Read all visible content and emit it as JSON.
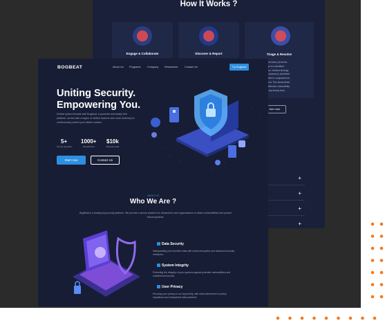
{
  "back_page": {
    "section_title": "How It Works ?",
    "cards": [
      {
        "label": "Engage & Collaborate",
        "icon": "collaborate-illustration"
      },
      {
        "label": "Discover & Report",
        "icon": "hacker-illustration"
      },
      {
        "label": "Triage & Resolve",
        "icon": "triage-illustration"
      }
    ],
    "triage_text_lines": [
      "xpert team performs",
      "age on submitted",
      "ures. Verified findings",
      "ly assessed, prioritized",
      "cated to companies for",
      "ment. This streamlined",
      "s effective vulnerability",
      "nt and timely fixes."
    ],
    "join_label": "Join now",
    "faq_items": [
      "+",
      "+",
      "+",
      "+"
    ]
  },
  "front_page": {
    "logo": "BOGBEAT",
    "nav": [
      "About Us",
      "Programs",
      "Company",
      "Researcher",
      "Contact Us"
    ],
    "login_label": "Try Bugbeat",
    "hero_title_line1": "Uniting Security.",
    "hero_title_line2": "Empowering You.",
    "hero_desc": "Defeat cybercriminals with Bugbeat, a powerful and totally free platform, armed with a legion of skilled hackers who work tirelessly to continuously protect your attack surface.",
    "stats": [
      {
        "value": "5+",
        "label": "bounty programs"
      },
      {
        "value": "1000+",
        "label": "Researchers"
      },
      {
        "value": "$10k",
        "label": "Bounties paid"
      }
    ],
    "start_label": "Start now",
    "contact_label": "Contact Us",
    "about_tag": "ABOUT US",
    "about_title": "Who We Are ?",
    "about_desc": "BugBeat is a leading bug bounty platform. We provide a secure platform for researchers and organizations to detect vulnerabilities and protect critical systems.",
    "features": [
      {
        "title": "Data Security",
        "icon": "lock-icon",
        "desc": "Safeguarding your sensitive data with robust encryption and advanced security measures."
      },
      {
        "title": "System Integrity",
        "icon": "shield-icon",
        "desc": "Protecting the integrity of your systems against potential vulnerabilities and unauthorized access."
      },
      {
        "title": "User Privacy",
        "icon": "user-lock-icon",
        "desc": "Ensuring your privacy is our top priority, with strict adherence to privacy regulations and transparent data practices."
      }
    ]
  },
  "colors": {
    "accent": "#2d8fe0",
    "dot_orange": "#f07a24",
    "page_bg": "#171d34",
    "backdrop": "#2b2b2b"
  }
}
